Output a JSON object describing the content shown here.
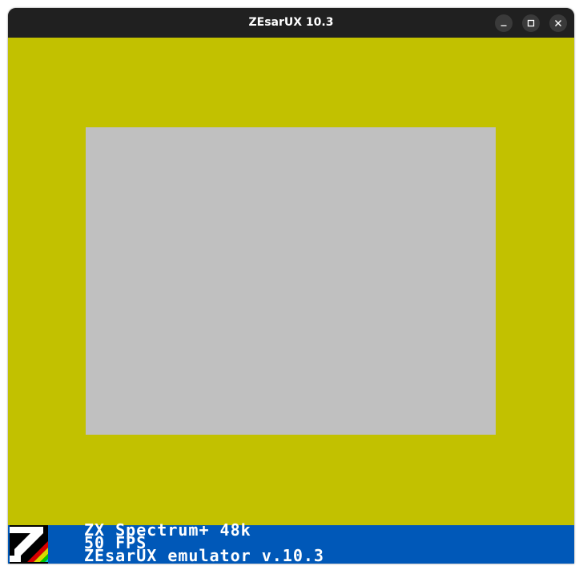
{
  "window": {
    "title": "ZEsarUX 10.3"
  },
  "screen": {
    "border_color": "#c2c100",
    "paper_color": "#c0c0c0"
  },
  "footer": {
    "background_color": "#0058b8",
    "line1": "ZX Spectrum+ 48k",
    "line2": "50 FPS",
    "line3": "ZEsarUX emulator v.10.3"
  },
  "icons": {
    "minimize": "minimize-icon",
    "maximize": "maximize-icon",
    "close": "close-icon",
    "logo": "zesarux-logo-icon"
  }
}
